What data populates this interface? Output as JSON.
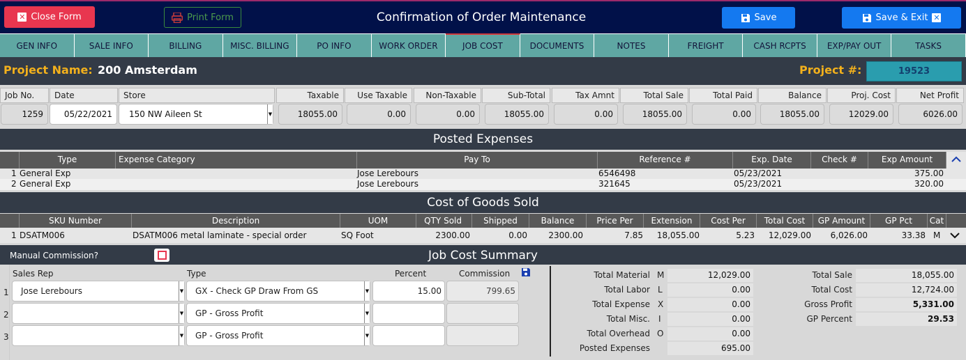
{
  "header": {
    "close_label": "Close Form",
    "print_label": "Print Form",
    "title": "Confirmation of Order Maintenance",
    "save_label": "Save",
    "save_exit_label": "Save & Exit"
  },
  "tabs": [
    "GEN INFO",
    "SALE INFO",
    "BILLING",
    "MISC. BILLING",
    "PO INFO",
    "WORK ORDER",
    "JOB COST",
    "DOCUMENTS",
    "NOTES",
    "FREIGHT",
    "CASH RCPTS",
    "EXP/PAY OUT",
    "TASKS"
  ],
  "active_tab": "JOB COST",
  "project": {
    "name_label": "Project Name:",
    "name": "200 Amsterdam",
    "num_label": "Project #:",
    "num": "19523"
  },
  "summary": {
    "headers": [
      "Job No.",
      "Date",
      "Store",
      "Taxable",
      "Use Taxable",
      "Non-Taxable",
      "Sub-Total",
      "Tax Amnt",
      "Total Sale",
      "Total Paid",
      "Balance",
      "Proj. Cost",
      "Net Profit"
    ],
    "values": [
      "1259",
      "05/22/2021",
      "150 NW Aileen St",
      "18055.00",
      "0.00",
      "0.00",
      "18055.00",
      "0.00",
      "18055.00",
      "0.00",
      "18055.00",
      "12029.00",
      "6026.00"
    ]
  },
  "posted_expenses": {
    "title": "Posted Expenses",
    "headers": [
      "Type",
      "Expense Category",
      "Pay To",
      "Reference #",
      "Exp. Date",
      "Check #",
      "Exp Amount"
    ],
    "rows": [
      {
        "n": "1",
        "type": "General Exp",
        "category": "",
        "pay_to": "Jose Lerebours",
        "ref": "6546498",
        "date": "05/23/2021",
        "check": "",
        "amount": "375.00"
      },
      {
        "n": "2",
        "type": "General Exp",
        "category": "",
        "pay_to": "Jose Lerebours",
        "ref": "321645",
        "date": "05/23/2021",
        "check": "",
        "amount": "320.00"
      }
    ]
  },
  "cogs": {
    "title": "Cost of Goods Sold",
    "headers": [
      "SKU Number",
      "Description",
      "UOM",
      "QTY Sold",
      "Shipped",
      "Balance",
      "Price Per",
      "Extension",
      "Cost Per",
      "Total Cost",
      "GP Amount",
      "GP Pct",
      "Cat"
    ],
    "rows": [
      {
        "n": "1",
        "sku": "DSATM006",
        "desc": "DSATM006 metal laminate - special order",
        "uom": "SQ Foot",
        "qty": "2300.00",
        "shipped": "0.00",
        "balance": "2300.00",
        "price": "7.85",
        "ext": "18,055.00",
        "cost": "5.23",
        "total_cost": "12,029.00",
        "gp_amt": "6,026.00",
        "gp_pct": "33.38",
        "cat": "M"
      }
    ]
  },
  "jcs": {
    "title": "Job Cost Summary",
    "manual_commission_label": "Manual Commission?",
    "headers": [
      "Sales Rep",
      "Type",
      "Percent",
      "Commission"
    ],
    "rows": [
      {
        "n": "1",
        "rep": "Jose Lerebours",
        "type": "GX - Check GP Draw From GS",
        "pct": "15.00",
        "comm": "799.65"
      },
      {
        "n": "2",
        "rep": "",
        "type": "GP - Gross Profit",
        "pct": "",
        "comm": ""
      },
      {
        "n": "3",
        "rep": "",
        "type": "GP - Gross Profit",
        "pct": "",
        "comm": ""
      }
    ],
    "totals_left": [
      {
        "label": "Total Material",
        "code": "M",
        "value": "12,029.00"
      },
      {
        "label": "Total Labor",
        "code": "L",
        "value": "0.00"
      },
      {
        "label": "Total Expense",
        "code": "X",
        "value": "0.00"
      },
      {
        "label": "Total Misc.",
        "code": "I",
        "value": "0.00"
      },
      {
        "label": "Total Overhead",
        "code": "O",
        "value": "0.00"
      },
      {
        "label": "Posted Expenses",
        "code": "",
        "value": "695.00"
      }
    ],
    "totals_right": [
      {
        "label": "Total Sale",
        "value": "18,055.00"
      },
      {
        "label": "Total Cost",
        "value": "12,724.00"
      },
      {
        "label": "Gross Profit",
        "value": "5,331.00"
      },
      {
        "label": "GP Percent",
        "value": "29.53"
      }
    ]
  },
  "colors": {
    "topbar": "#011149",
    "accent_red": "#e8364f",
    "accent_blue": "#1479f0",
    "tab_teal": "#5fa7a3",
    "project_label": "#f3b11c"
  }
}
